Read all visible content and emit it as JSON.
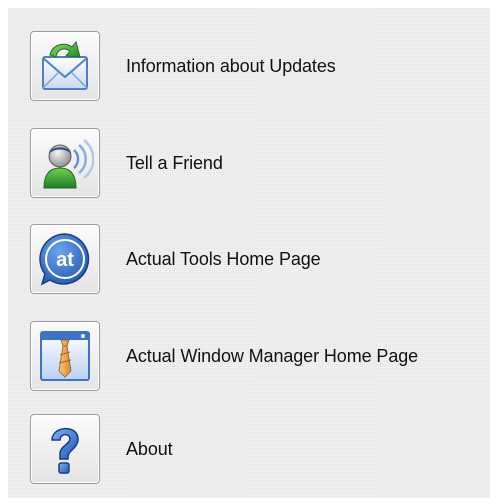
{
  "menu": {
    "items": [
      {
        "label": "Information about Updates",
        "icon": "mail-update-icon"
      },
      {
        "label": "Tell a Friend",
        "icon": "user-speaking-icon"
      },
      {
        "label": "Actual Tools Home Page",
        "icon": "actual-tools-logo-icon"
      },
      {
        "label": "Actual Window Manager Home Page",
        "icon": "window-manager-icon"
      },
      {
        "label": "About",
        "icon": "question-mark-icon"
      }
    ]
  },
  "colors": {
    "button_border": "#9d9d9d",
    "icon_blue": "#3a73c8",
    "icon_green": "#34a63a",
    "text": "#111111"
  }
}
